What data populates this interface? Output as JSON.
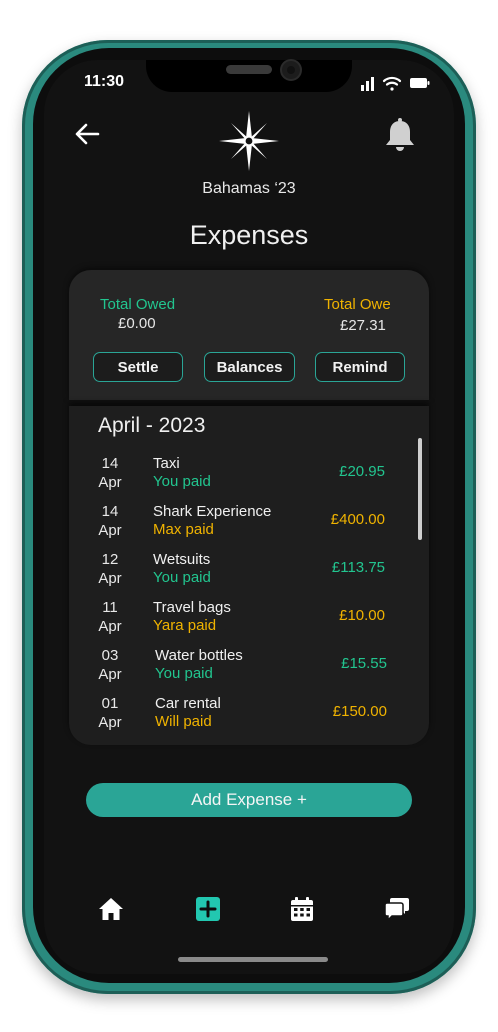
{
  "status_bar": {
    "time": "11:30"
  },
  "header": {
    "trip_name": "Bahamas ‘23",
    "title": "Expenses"
  },
  "summary": {
    "owed_label": "Total Owed",
    "owed_value": "£0.00",
    "owe_label": "Total Owe",
    "owe_value": "£27.31",
    "buttons": [
      "Settle",
      "Balances",
      "Remind"
    ]
  },
  "expenses": {
    "month_heading": "April - 2023",
    "items": [
      {
        "day": "14",
        "month": "Apr",
        "description": "Taxi",
        "payer": "You paid",
        "amount": "£20.95",
        "status": "green"
      },
      {
        "day": "14",
        "month": "Apr",
        "description": "Shark Experience",
        "payer": "Max paid",
        "amount": "£400.00",
        "status": "amber"
      },
      {
        "day": "12",
        "month": "Apr",
        "description": "Wetsuits",
        "payer": "You paid",
        "amount": "£113.75",
        "status": "green"
      },
      {
        "day": "11",
        "month": "Apr",
        "description": "Travel bags",
        "payer": "Yara paid",
        "amount": "£10.00",
        "status": "amber"
      },
      {
        "day": "03",
        "month": "Apr",
        "description": "Water bottles",
        "payer": "You paid",
        "amount": "£15.55",
        "status": "green"
      },
      {
        "day": "01",
        "month": "Apr",
        "description": "Car rental",
        "payer": "Will paid",
        "amount": "£150.00",
        "status": "amber"
      }
    ]
  },
  "add_button_label": "Add Expense +",
  "colors": {
    "accent": "#2aa596",
    "frame": "#2a8a7e",
    "owed_green": "#22c58f",
    "owe_amber": "#f0b300"
  },
  "icons": [
    "back-arrow-icon",
    "compass-logo-icon",
    "bell-icon",
    "home-icon",
    "add-square-icon",
    "calendar-icon",
    "chat-icon"
  ]
}
